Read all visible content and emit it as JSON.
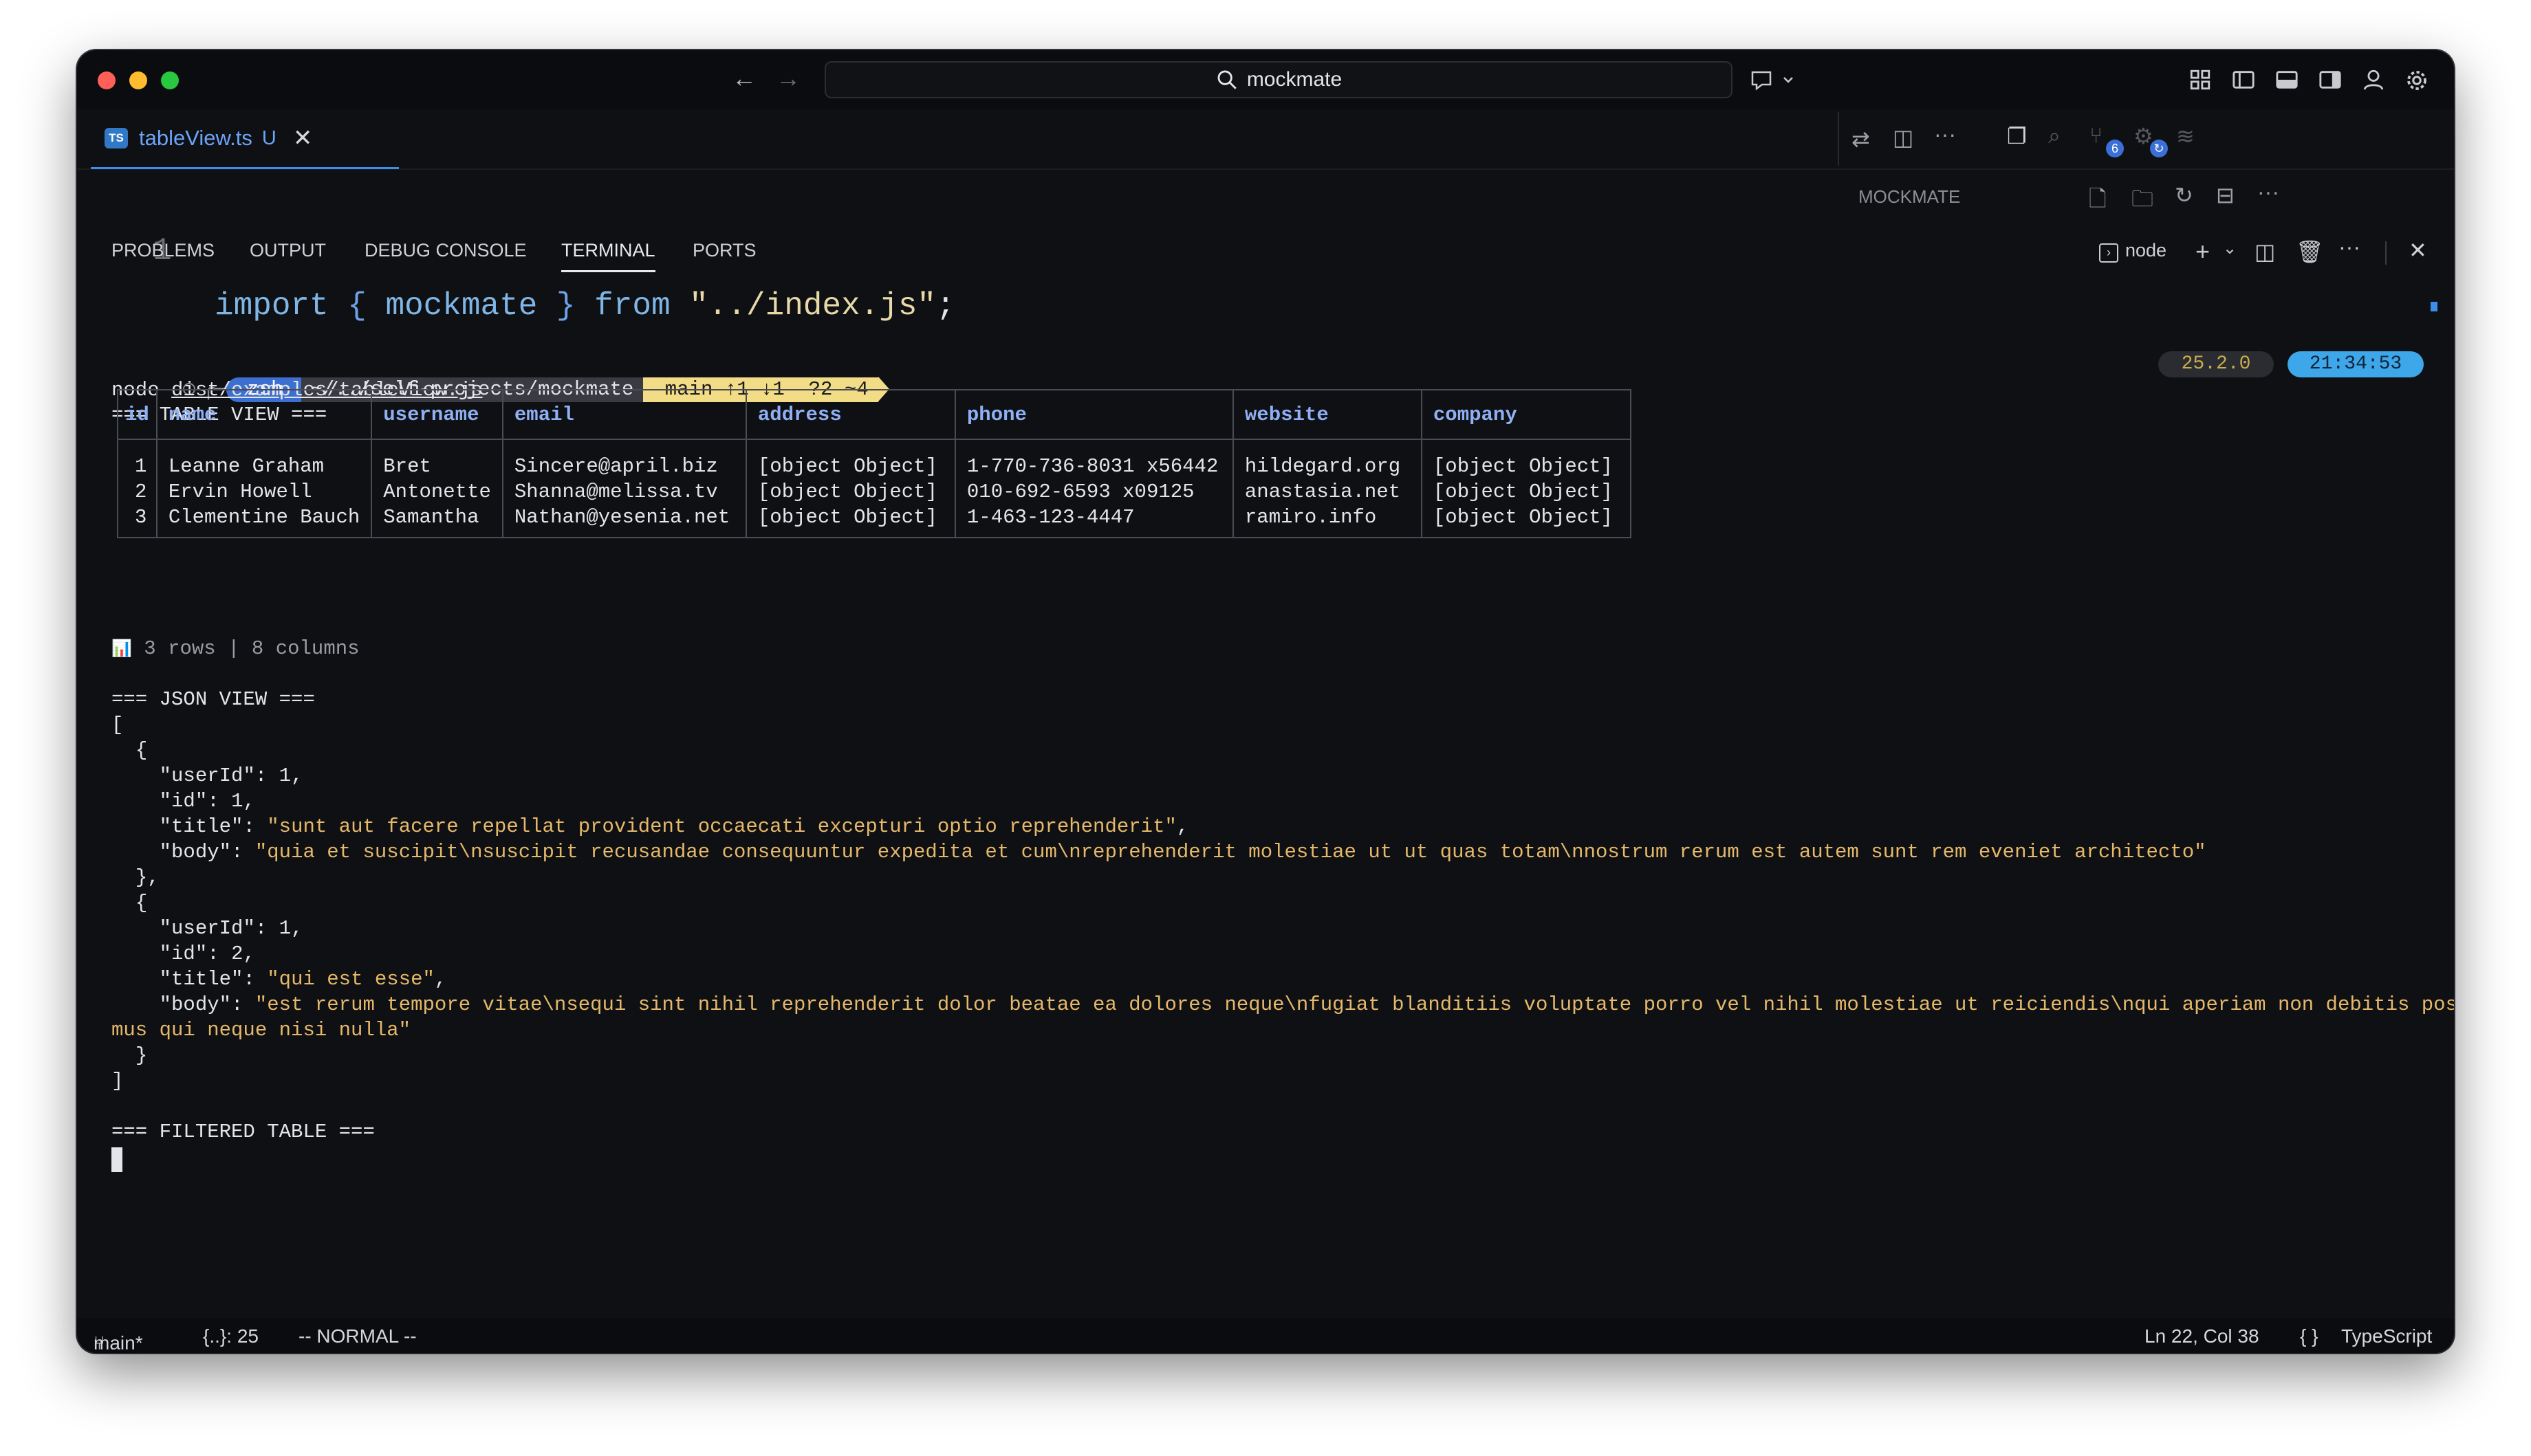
{
  "titlebar": {
    "search_text": "mockmate"
  },
  "tab": {
    "badge": "TS",
    "name": "tableView.ts",
    "modified": "U"
  },
  "editor": {
    "line_number": "1",
    "kw_import": "import",
    "brace_open": "{",
    "ident": "mockmate",
    "brace_close": "}",
    "kw_from": "from",
    "path": "\"../index.js\"",
    "semi": ";"
  },
  "explorer": {
    "title": "MOCKMATE",
    "scm_badge": "6"
  },
  "panel": {
    "tabs": [
      "PROBLEMS",
      "OUTPUT",
      "DEBUG CONSOLE",
      "TERMINAL",
      "PORTS"
    ],
    "active_tab": "TERMINAL",
    "shell_name": "node"
  },
  "prompt": {
    "shell": "zsh",
    "cwd": "~/../self-projects/mockmate",
    "git": " main ↑1 ↓1  ?2 ~4",
    "node_version": "25.2.0",
    "time": "21:34:53"
  },
  "command": {
    "prefix": "node",
    "arg": "dist/examples/tableView.js"
  },
  "table_view": {
    "heading": "=== TABLE VIEW ===",
    "columns": [
      "id",
      "name",
      "username",
      "email",
      "address",
      "phone",
      "website",
      "company"
    ],
    "rows": [
      [
        "1",
        "Leanne Graham",
        "Bret",
        "Sincere@april.biz",
        "[object Object]",
        "1-770-736-8031 x56442",
        "hildegard.org",
        "[object Object]"
      ],
      [
        "2",
        "Ervin Howell",
        "Antonette",
        "Shanna@melissa.tv",
        "[object Object]",
        "010-692-6593 x09125",
        "anastasia.net",
        "[object Object]"
      ],
      [
        "3",
        "Clementine Bauch",
        "Samantha",
        "Nathan@yesenia.net",
        "[object Object]",
        "1-463-123-4447",
        "ramiro.info",
        "[object Object]"
      ]
    ],
    "summary_icon": "📊",
    "summary": "3 rows | 8 columns"
  },
  "json_view": {
    "heading": "=== JSON VIEW ===",
    "open": "[",
    "close": "]",
    "obj_open": "{",
    "obj_close_comma": "},",
    "obj_close": "}",
    "items": [
      {
        "userId": "1",
        "id": "1",
        "title": "\"sunt aut facere repellat provident occaecati excepturi optio reprehenderit\"",
        "body": "\"quia et suscipit\\nsuscipit recusandae consequuntur expedita et cum\\nreprehenderit molestiae ut ut quas totam\\nnostrum rerum est autem sunt rem eveniet architecto\""
      },
      {
        "userId": "1",
        "id": "2",
        "title": "\"qui est esse\"",
        "body": "\"est rerum tempore vitae\\nsequi sint nihil reprehenderit dolor beatae ea dolores neque\\nfugiat blanditiis voluptate porro vel nihil molestiae ut reiciendis\\nqui aperiam non debitis possi",
        "body_cont": "mus qui neque nisi nulla\""
      }
    ],
    "keys": {
      "userId": "\"userId\"",
      "id": "\"id\"",
      "title": "\"title\"",
      "body": "\"body\""
    }
  },
  "filtered_heading": "=== FILTERED TABLE ===",
  "status": {
    "branch": "main*",
    "symbols": "{..}: 25",
    "mode": "-- NORMAL --",
    "position": "Ln 22, Col 38",
    "language": "TypeScript"
  },
  "colors": {
    "accent": "#3b8eea",
    "keyword": "#7fb6e6",
    "string": "#e5b86a",
    "git_segment": "#f3dc86",
    "time_pill": "#3da7ea"
  }
}
